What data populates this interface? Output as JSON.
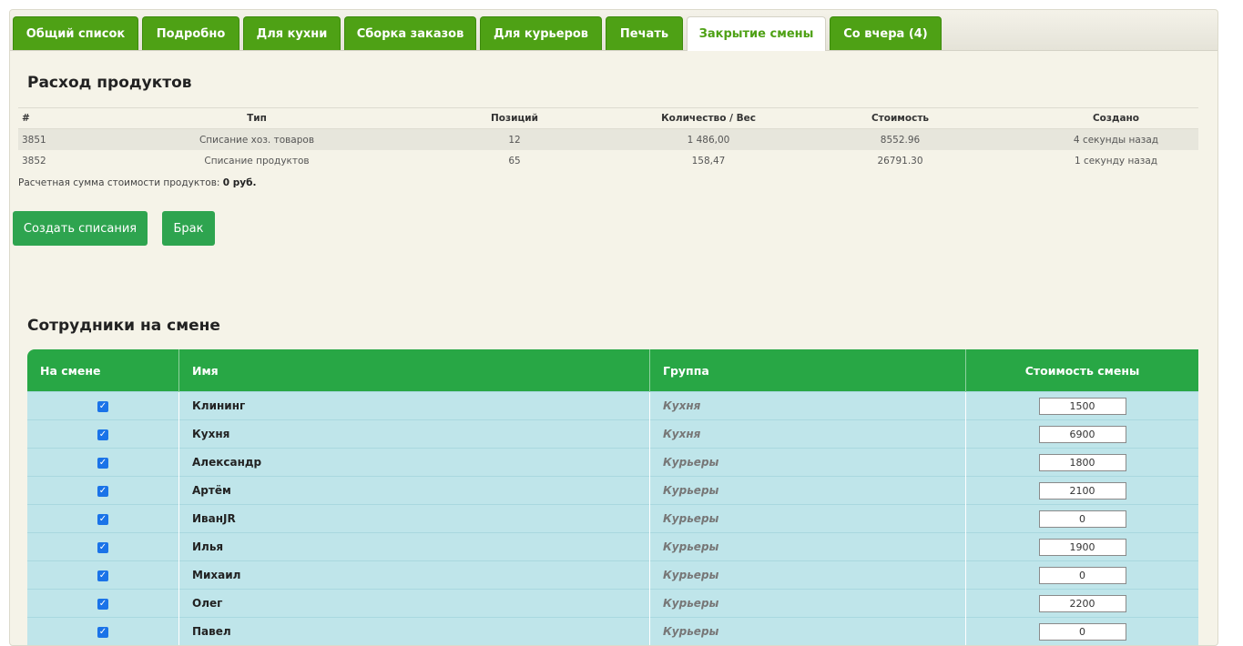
{
  "tabs": [
    {
      "label": "Общий список",
      "active": false
    },
    {
      "label": "Подробно",
      "active": false
    },
    {
      "label": "Для кухни",
      "active": false
    },
    {
      "label": "Сборка заказов",
      "active": false
    },
    {
      "label": "Для курьеров",
      "active": false
    },
    {
      "label": "Печать",
      "active": false
    },
    {
      "label": "Закрытие смены",
      "active": true
    },
    {
      "label": "Со вчера (4)",
      "active": false
    }
  ],
  "expenses": {
    "title": "Расход продуктов",
    "headers": [
      "#",
      "Тип",
      "Позиций",
      "Количество / Вес",
      "Стоимость",
      "Создано"
    ],
    "rows": [
      {
        "id": "3851",
        "type": "Списание хоз. товаров",
        "positions": "12",
        "qty": "1 486,00",
        "cost": "8552.96",
        "created": "4 секунды назад"
      },
      {
        "id": "3852",
        "type": "Списание продуктов",
        "positions": "65",
        "qty": "158,47",
        "cost": "26791.30",
        "created": "1 секунду назад"
      }
    ],
    "summary_label": "Расчетная сумма стоимости продуктов:",
    "summary_value": "0 руб."
  },
  "buttons": {
    "create": "Создать списания",
    "defect": "Брак"
  },
  "staff": {
    "title": "Сотрудники на смене",
    "headers": [
      "На смене",
      "Имя",
      "Группа",
      "Стоимость смены"
    ],
    "rows": [
      {
        "on_shift": true,
        "name": "Клининг",
        "group": "Кухня",
        "cost": "1500"
      },
      {
        "on_shift": true,
        "name": "Кухня",
        "group": "Кухня",
        "cost": "6900"
      },
      {
        "on_shift": true,
        "name": "Александр",
        "group": "Курьеры",
        "cost": "1800"
      },
      {
        "on_shift": true,
        "name": "Артём",
        "group": "Курьеры",
        "cost": "2100"
      },
      {
        "on_shift": true,
        "name": "ИванJR",
        "group": "Курьеры",
        "cost": "0"
      },
      {
        "on_shift": true,
        "name": "Илья",
        "group": "Курьеры",
        "cost": "1900"
      },
      {
        "on_shift": true,
        "name": "Михаил",
        "group": "Курьеры",
        "cost": "0"
      },
      {
        "on_shift": true,
        "name": "Олег",
        "group": "Курьеры",
        "cost": "2200"
      },
      {
        "on_shift": true,
        "name": "Павел",
        "group": "Курьеры",
        "cost": "0"
      }
    ]
  },
  "colors": {
    "tab_green": "#4ea115",
    "button_green": "#2ea44f",
    "table_header_green": "#28a745",
    "row_blue": "#bfe5ea",
    "panel_bg": "#f5f3e8"
  }
}
